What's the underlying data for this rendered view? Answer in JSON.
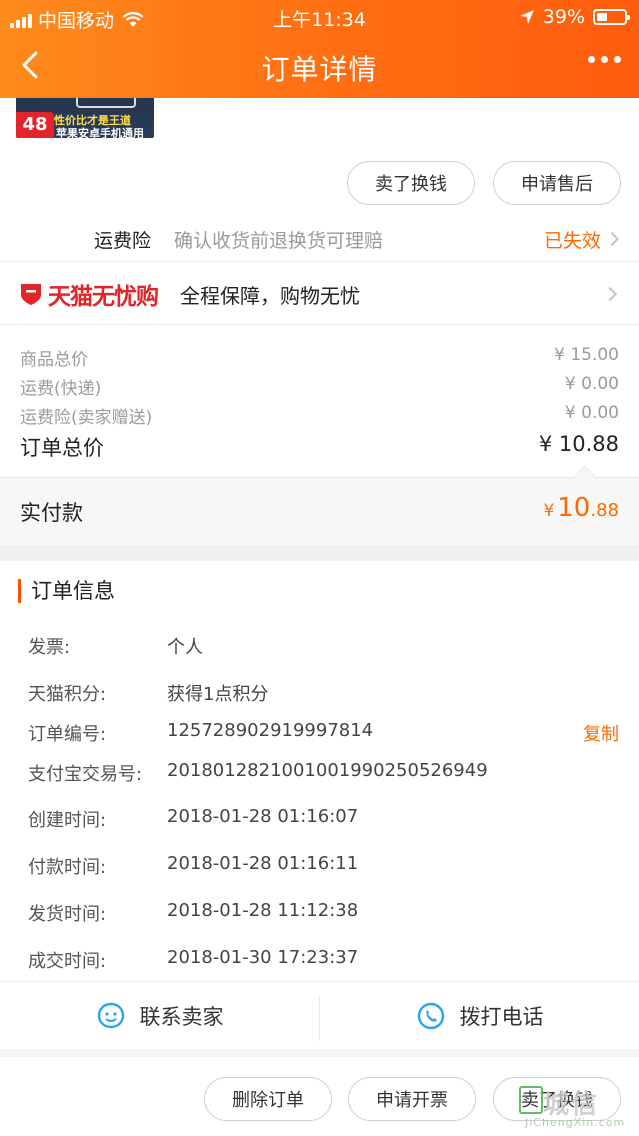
{
  "status_bar": {
    "carrier": "中国移动",
    "time": "上午11:34",
    "battery_percent": "39%",
    "battery_level": 0.39
  },
  "nav": {
    "title": "订单详情"
  },
  "product": {
    "thumb_badge": "48",
    "thumb_tagline": "性价比才是王道",
    "thumb_sub": "苹果安卓手机通用"
  },
  "actions_top": {
    "sell": "卖了换钱",
    "after_sale": "申请售后"
  },
  "shipping_insurance": {
    "name": "运费险",
    "desc": "确认收货前退换货可理赔",
    "status": "已失效"
  },
  "tmall_assurance": {
    "brand": "天猫无忧购",
    "slogan": "全程保障，购物无忧"
  },
  "prices": [
    {
      "label": "商品总价",
      "value": "¥ 15.00"
    },
    {
      "label": "运费(快递)",
      "value": "¥ 0.00"
    },
    {
      "label": "运费险(卖家赠送)",
      "value": "¥ 0.00"
    }
  ],
  "order_total": {
    "label": "订单总价",
    "value": "¥ 10.88"
  },
  "paid": {
    "label": "实付款",
    "currency": "¥",
    "integer": "10",
    "decimal": ".88"
  },
  "order_info": {
    "title": "订单信息",
    "copy_label": "复制",
    "rows": [
      {
        "key": "发票:",
        "value": "个人"
      },
      {
        "key": "天猫积分:",
        "value": "获得1点积分"
      },
      {
        "key": "订单编号:",
        "value": "125728902919997814"
      },
      {
        "key": "支付宝交易号:",
        "value": "2018012821001001990250526949"
      },
      {
        "key": "创建时间:",
        "value": "2018-01-28 01:16:07"
      },
      {
        "key": "付款时间:",
        "value": "2018-01-28 01:16:11"
      },
      {
        "key": "发货时间:",
        "value": "2018-01-28 11:12:38"
      },
      {
        "key": "成交时间:",
        "value": "2018-01-30 17:23:37"
      }
    ]
  },
  "contact": {
    "seller": "联系卖家",
    "call": "拨打电话"
  },
  "bottom_actions": {
    "delete": "删除订单",
    "invoice": "申请开票",
    "sell": "卖了换钱"
  },
  "watermark": {
    "main": "城信",
    "sub": "JiChengXin.com"
  },
  "colors": {
    "accent": "#ff6a00",
    "tmall_red": "#e3242b"
  }
}
